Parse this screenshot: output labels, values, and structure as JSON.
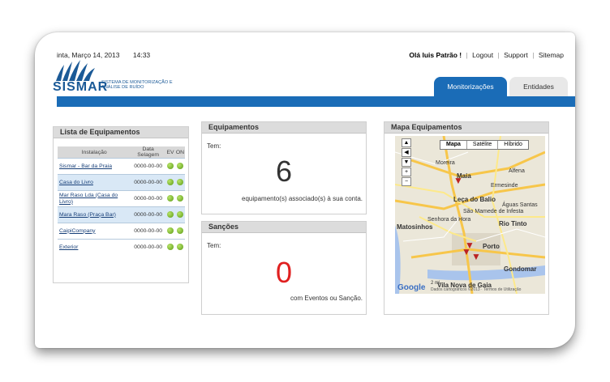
{
  "header": {
    "datetime": "inta, Março 14, 2013",
    "time": "14:33",
    "greeting": "Olá luis Patrão !",
    "links": [
      "Logout",
      "Support",
      "Sitemap"
    ]
  },
  "logo": {
    "wordmark": "SISMAR",
    "tagline": "SISTEMA DE MONITORIZAÇÃO E ANÁLISE DE RUÍDO"
  },
  "tabs": [
    {
      "label": "Monitorizações",
      "active": true
    },
    {
      "label": "Entidades",
      "active": false
    }
  ],
  "equipment_list": {
    "title": "Lista de Equipamentos",
    "columns": [
      "Instalação",
      "Data Selagem",
      "EV",
      "ON"
    ],
    "rows": [
      {
        "name": "Sismar - Bar da Praia",
        "date": "0000-00-00"
      },
      {
        "name": "Casa do Livro",
        "date": "0000-00-00"
      },
      {
        "name": "Mar Raso Lda (Casa do Livro)",
        "date": "0000-00-00"
      },
      {
        "name": "Mara Raso (Praça Bar)",
        "date": "0000-00-00"
      },
      {
        "name": "CaipiCompany",
        "date": "0000-00-00"
      },
      {
        "name": "Exterior",
        "date": "0000-00-00"
      }
    ]
  },
  "equipamentos": {
    "title": "Equipamentos",
    "tem": "Tem:",
    "count": "6",
    "note": "equipamento(s) associado(s) à sua conta."
  },
  "sancoes": {
    "title": "Sanções",
    "tem": "Tem:",
    "count": "0",
    "note": "com Eventos ou Sanção."
  },
  "map": {
    "title": "Mapa Equipamentos",
    "types": [
      "Mapa",
      "Satélite",
      "Híbrido"
    ],
    "selected_type": "Mapa",
    "labels": [
      "Moreira",
      "Alfena",
      "Maia",
      "Ermesinde",
      "Leça do Balio",
      "Senhora da Hora",
      "Rio Tinto",
      "Matosinhos",
      "Porto",
      "Gondomar",
      "Vila Nova de Gaia",
      "Águas Santas",
      "São Mamede de Infesta"
    ],
    "brand": "Google",
    "scale": "2 mi",
    "attribution": "Dados cartográficos ©2013 · Termos de Utilização"
  },
  "colors": {
    "accent": "#1a6cb7",
    "sancao_count": "#e02020",
    "status_dot": "#6cb51e"
  }
}
